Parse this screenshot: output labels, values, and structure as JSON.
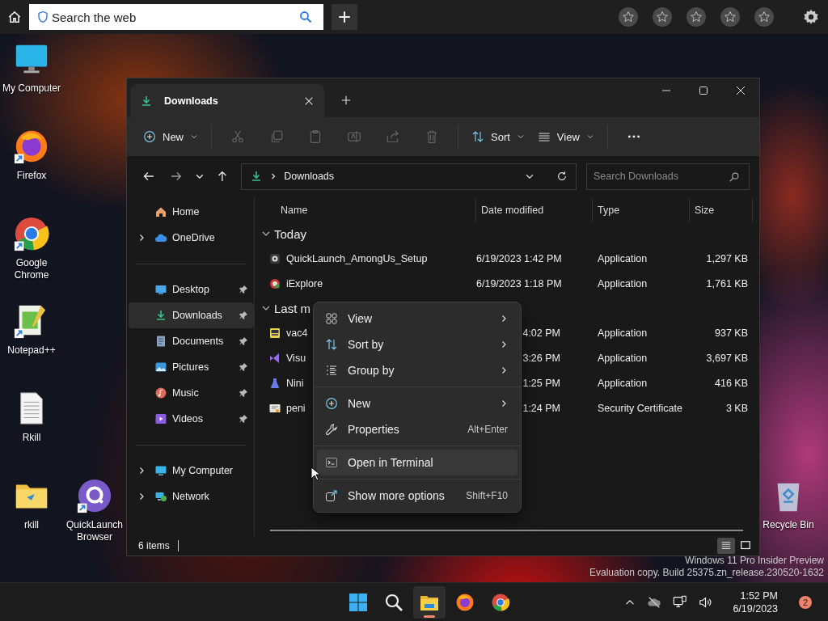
{
  "browser_bar": {
    "search": {
      "placeholder": "Search the web"
    }
  },
  "desktop_icons": [
    {
      "label": "My Computer",
      "kind": "monitor",
      "shortcut": false
    },
    {
      "label": "Firefox",
      "kind": "firefox",
      "shortcut": true
    },
    {
      "label": "Google Chrome",
      "kind": "chrome",
      "shortcut": true
    },
    {
      "label": "Notepad++",
      "kind": "notepad",
      "shortcut": true
    },
    {
      "label": "Rkill",
      "kind": "textfile",
      "shortcut": false
    },
    {
      "label": "rkill",
      "kind": "folder",
      "shortcut": false
    },
    {
      "label": "QuickLaunch Browser",
      "kind": "quicklaunch",
      "shortcut": true
    }
  ],
  "recycle_bin": {
    "label": "Recycle Bin"
  },
  "explorer": {
    "tabs": [
      {
        "title": "Downloads",
        "selected": true
      }
    ],
    "toolbar": {
      "new": "New",
      "sort": "Sort",
      "view": "View"
    },
    "address": {
      "crumb": "Downloads"
    },
    "search": {
      "placeholder": "Search Downloads"
    },
    "sidebar": {
      "groups": [
        [
          {
            "label": "Home",
            "kind": "home",
            "expandable": false,
            "pinned": false,
            "selected": false
          },
          {
            "label": "OneDrive",
            "kind": "cloud",
            "expandable": true,
            "pinned": false,
            "selected": false
          }
        ],
        [
          {
            "label": "Desktop",
            "kind": "desktop",
            "expandable": false,
            "pinned": true,
            "selected": false
          },
          {
            "label": "Downloads",
            "kind": "download",
            "expandable": false,
            "pinned": true,
            "selected": true
          },
          {
            "label": "Documents",
            "kind": "document",
            "expandable": false,
            "pinned": true,
            "selected": false
          },
          {
            "label": "Pictures",
            "kind": "picture",
            "expandable": false,
            "pinned": true,
            "selected": false
          },
          {
            "label": "Music",
            "kind": "music",
            "expandable": false,
            "pinned": true,
            "selected": false
          },
          {
            "label": "Videos",
            "kind": "video",
            "expandable": false,
            "pinned": true,
            "selected": false
          }
        ],
        [
          {
            "label": "My Computer",
            "kind": "pc",
            "expandable": true,
            "pinned": false,
            "selected": false
          },
          {
            "label": "Network",
            "kind": "network",
            "expandable": true,
            "pinned": false,
            "selected": false
          }
        ]
      ]
    },
    "columns": [
      "Name",
      "Date modified",
      "Type",
      "Size"
    ],
    "groups": [
      {
        "label": "Today",
        "expanded": true,
        "rows": [
          {
            "name": "QuickLaunch_AmongUs_Setup",
            "kind": "disc",
            "date": "6/19/2023 1:42 PM",
            "type": "Application",
            "size": "1,297 KB"
          },
          {
            "name": "iExplore",
            "kind": "badge",
            "date": "6/19/2023 1:18 PM",
            "type": "Application",
            "size": "1,761 KB"
          }
        ]
      },
      {
        "label": "Last m",
        "expanded": true,
        "rows": [
          {
            "name": "vac4",
            "kind": "app",
            "date": "4:02 PM",
            "type": "Application",
            "size": "937 KB"
          },
          {
            "name": "Visu",
            "kind": "vs",
            "date": "3:26 PM",
            "type": "Application",
            "size": "3,697 KB"
          },
          {
            "name": "Nini",
            "kind": "ninite",
            "date": "1:25 PM",
            "type": "Application",
            "size": "416 KB"
          },
          {
            "name": "peni",
            "kind": "cert",
            "date": "1:24 PM",
            "type": "Security Certificate",
            "size": "3 KB"
          }
        ]
      }
    ],
    "status": "6 items",
    "view_modes": [
      {
        "kind": "details",
        "selected": true
      },
      {
        "kind": "tiles",
        "selected": false
      }
    ]
  },
  "context_menu": {
    "sections": [
      [
        {
          "label": "View",
          "kind": "grid",
          "submenu": true,
          "selected": false
        },
        {
          "label": "Sort by",
          "kind": "sort",
          "submenu": true,
          "selected": false
        },
        {
          "label": "Group by",
          "kind": "list",
          "submenu": true,
          "selected": false
        }
      ],
      [
        {
          "label": "New",
          "kind": "plus",
          "submenu": true,
          "selected": false
        },
        {
          "label": "Properties",
          "kind": "wrench",
          "submenu": false,
          "shortcut": "Alt+Enter",
          "selected": false
        }
      ],
      [
        {
          "label": "Open in Terminal",
          "kind": "terminal",
          "submenu": false,
          "selected": true
        }
      ],
      [
        {
          "label": "Show more options",
          "kind": "external",
          "submenu": false,
          "shortcut": "Shift+F10",
          "selected": false
        }
      ]
    ]
  },
  "edition_notice": [
    "Windows 11 Pro Insider Preview",
    "Evaluation copy. Build 25375.zn_release.230520-1632"
  ],
  "taskbar": {
    "apps": [
      {
        "kind": "start",
        "selected": false
      },
      {
        "kind": "search",
        "selected": false
      },
      {
        "kind": "explorer",
        "selected": true
      },
      {
        "kind": "firefox",
        "selected": false
      },
      {
        "kind": "chrome",
        "selected": false
      }
    ],
    "time": "1:52 PM",
    "date": "6/19/2023",
    "notifications": "2"
  }
}
